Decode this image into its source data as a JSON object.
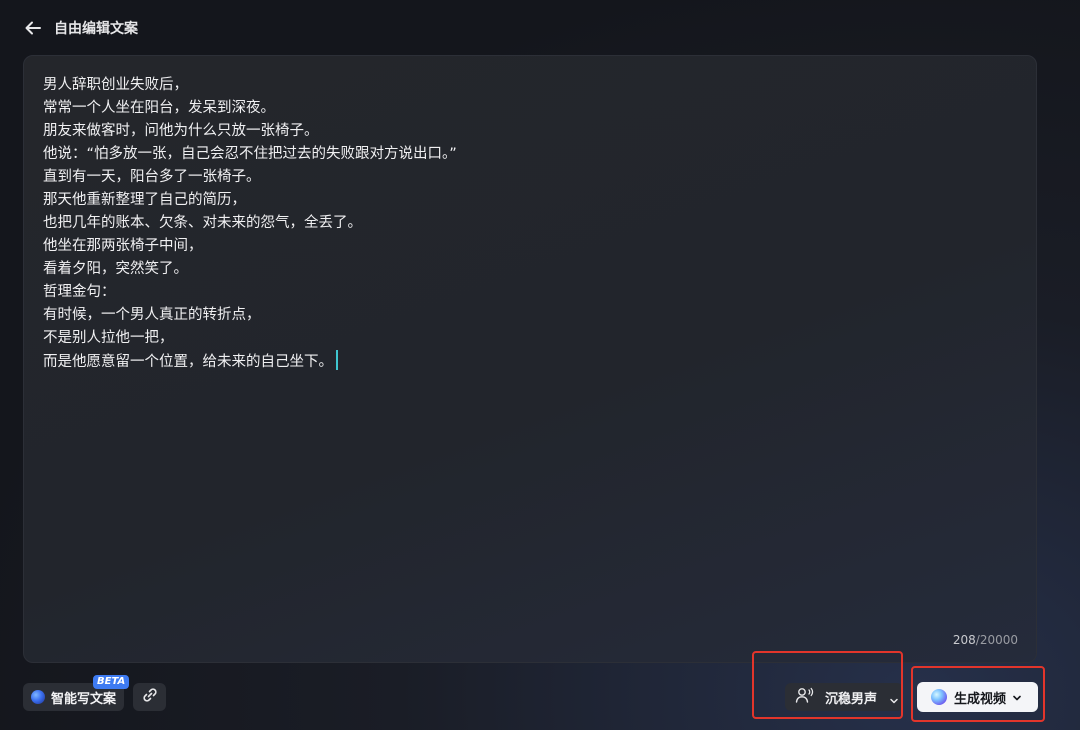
{
  "header": {
    "title": "自由编辑文案"
  },
  "editor": {
    "lines": [
      "男人辞职创业失败后，",
      "常常一个人坐在阳台，发呆到深夜。",
      "朋友来做客时，问他为什么只放一张椅子。",
      "他说：“怕多放一张，自己会忍不住把过去的失败跟对方说出口。”",
      "直到有一天，阳台多了一张椅子。",
      "那天他重新整理了自己的简历，",
      "也把几年的账本、欠条、对未来的怨气，全丢了。",
      "他坐在那两张椅子中间，",
      "看着夕阳，突然笑了。",
      "哲理金句：",
      "有时候，一个男人真正的转折点，",
      "不是别人拉他一把，",
      "而是他愿意留一个位置，给未来的自己坐下。"
    ],
    "char_count": "208",
    "char_limit": "/20000"
  },
  "toolbar": {
    "ai_write_label": "智能写文案",
    "beta_badge": "BETA",
    "voice_label": "沉稳男声",
    "generate_label": "生成视频"
  },
  "icons": {
    "back": "arrow-left-icon",
    "link": "link-icon",
    "voice": "person-voice-icon",
    "chevron": "chevron-down-icon"
  },
  "colors": {
    "accent_blue": "#3e7bf2",
    "highlight_red": "#e2352b",
    "caret": "#3fc6d0"
  }
}
